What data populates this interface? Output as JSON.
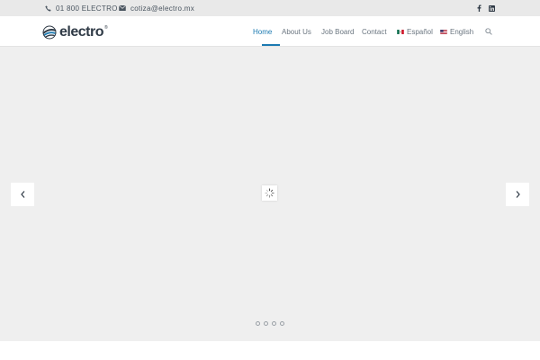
{
  "topbar": {
    "phone": "01 800 ELECTRO",
    "email": "cotiza@electro.mx",
    "social": [
      "facebook-icon",
      "linkedin-icon"
    ]
  },
  "header": {
    "logo_text": "electro",
    "logo_mark": "®"
  },
  "nav": {
    "items": [
      "Home",
      "About Us",
      "Job Board",
      "Contact",
      "Español",
      "English"
    ],
    "active": "Home"
  },
  "slider": {
    "slide_count": 4,
    "active_slide": 1
  },
  "colors": {
    "accent": "#1c7ab1",
    "topbar_bg": "#e9e9e9",
    "slider_bg": "#efefef",
    "text_dark": "#2f3a46"
  }
}
